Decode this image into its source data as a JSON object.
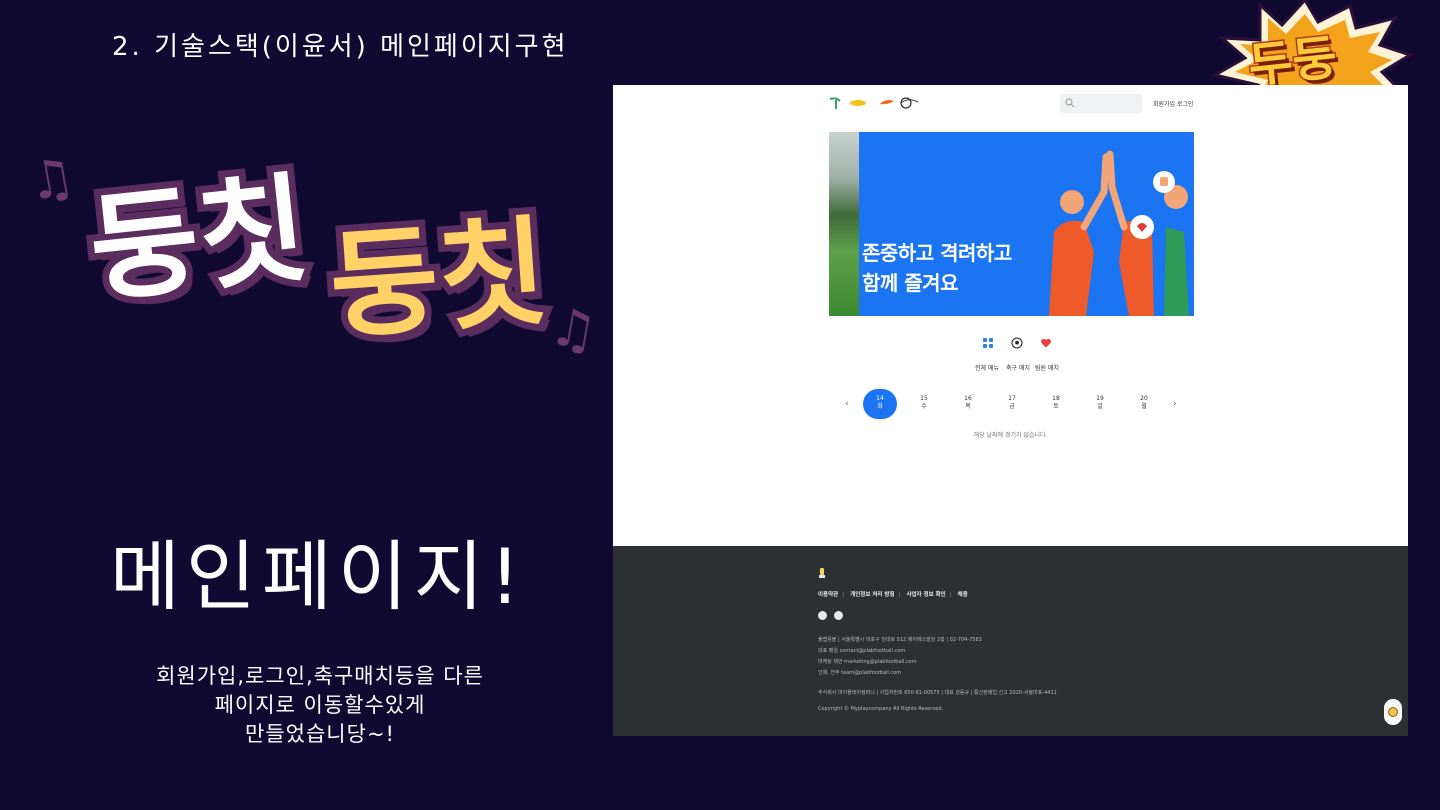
{
  "slide": {
    "title": "2. 기술스택(이윤서) 메인페이지구현",
    "dungchit_1": "둥칫",
    "dungchit_2": "둥칫",
    "music_note": "♫",
    "main_label": "메인페이지!",
    "description": [
      "회원가입,로그인,축구매치등을  다른",
      "페이지로 이동할수있게",
      "만들었습니당~!"
    ],
    "burst_text": "두둥"
  },
  "site": {
    "header": {
      "signup": "회원가입",
      "login": "로그인",
      "search_placeholder": ""
    },
    "banner": {
      "line1": "존중하고 격려하고",
      "line2": "함께 즐겨요"
    },
    "categories": [
      {
        "label": "전체 메뉴",
        "icon": "grid-icon"
      },
      {
        "label": "축구 매치",
        "icon": "soccer-ball-icon"
      },
      {
        "label": "팀원 매치",
        "icon": "heart-icon"
      }
    ],
    "dates": [
      {
        "num": "14",
        "day": "화",
        "active": true
      },
      {
        "num": "15",
        "day": "수"
      },
      {
        "num": "16",
        "day": "목"
      },
      {
        "num": "17",
        "day": "금"
      },
      {
        "num": "18",
        "day": "토"
      },
      {
        "num": "19",
        "day": "일"
      },
      {
        "num": "20",
        "day": "월"
      }
    ],
    "prev_arrow": "‹",
    "next_arrow": "›",
    "empty_message": "해당 날짜에 경기가 없습니다.",
    "footer": {
      "links": [
        "이용약관",
        "개인정보 처리 방침",
        "사업자 정보 확인",
        "채용"
      ],
      "info": [
        "플랩풋볼 | 서울특별시 마포구 천대로 512 제이에스빌딩 2층 | 02-704-7583",
        "대표 메일 contact@plabfootball.com",
        "마케팅 제안 marketing@plabfootball.com",
        "인재, 전무 team@plabfootball.com"
      ],
      "business": "주식회사 마이플레이컴퍼니 | 사업자번호 650-81-00575 | 대표 강동규 | 통신판매업 신고 2020-서울마포-4411",
      "copyright": "Copyright © Myplaycompany All Rights Reserved."
    }
  },
  "colors": {
    "background": "#100a33",
    "banner_blue": "#1b74f1",
    "accent_yellow": "#ffd166",
    "purple_outline": "#5b2d5e",
    "footer_dark": "#2d3033"
  }
}
